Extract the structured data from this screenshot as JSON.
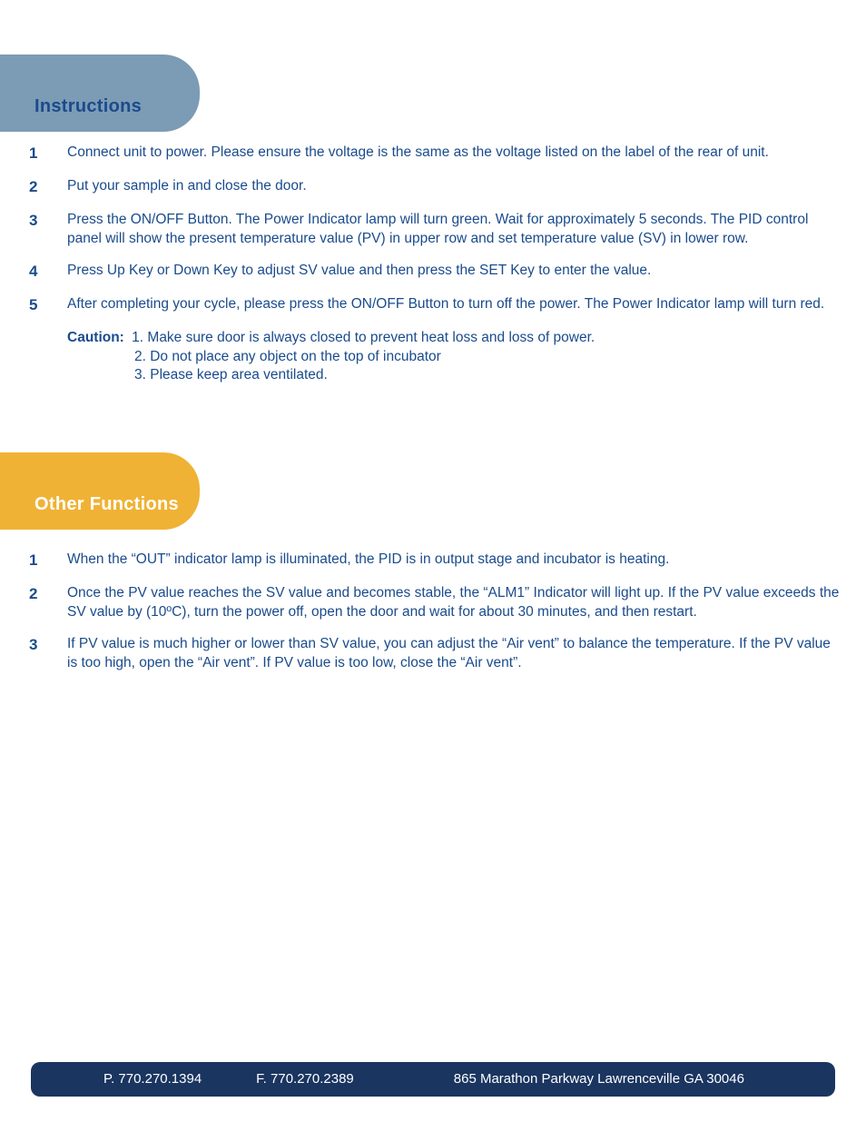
{
  "section1": {
    "title": "Instructions",
    "items": [
      {
        "n": "1",
        "t": "Connect unit to power. Please ensure the voltage is the same as the voltage listed on the label of the rear of unit."
      },
      {
        "n": "2",
        "t": "Put your sample in and close the door."
      },
      {
        "n": "3",
        "t": "Press the ON/OFF Button.  The Power Indicator lamp will turn green. Wait for approximately 5 seconds.  The PID control panel will show the present temperature value (PV) in upper row and set temperature value (SV) in lower row."
      },
      {
        "n": "4",
        "t": "Press Up Key or Down Key to adjust SV value and then press the SET Key to enter the value."
      },
      {
        "n": "5",
        "t": "After completing your cycle, please press the ON/OFF Button to turn off the power.  The Power Indicator lamp will turn red."
      }
    ],
    "caution_label": "Caution:",
    "caution_first": "1. Make sure door is always closed to prevent heat loss and loss of power.",
    "caution_rest": [
      "2. Do not place any object on the top of incubator",
      "3. Please keep area ventilated."
    ]
  },
  "section2": {
    "title": "Other Functions",
    "items": [
      {
        "n": "1",
        "t": "When the “OUT” indicator lamp is illuminated, the PID is in output stage and incubator is heating."
      },
      {
        "n": "2",
        "t": "Once the PV value reaches the SV value and becomes stable, the “ALM1” Indicator will light up.  If the PV value exceeds the SV value by (10ºC), turn the power off, open the door and wait for about 30 minutes, and then restart."
      },
      {
        "n": "3",
        "t": "If PV value is much higher or lower than SV value, you can adjust the “Air vent” to balance the temperature. If the PV value is too high, open the “Air vent”.  If PV value is too low, close the “Air vent”."
      }
    ]
  },
  "footer": {
    "phone": "P. 770.270.1394",
    "fax": "F. 770.270.2389",
    "addr": "865 Marathon Parkway Lawrenceville GA 30046"
  }
}
